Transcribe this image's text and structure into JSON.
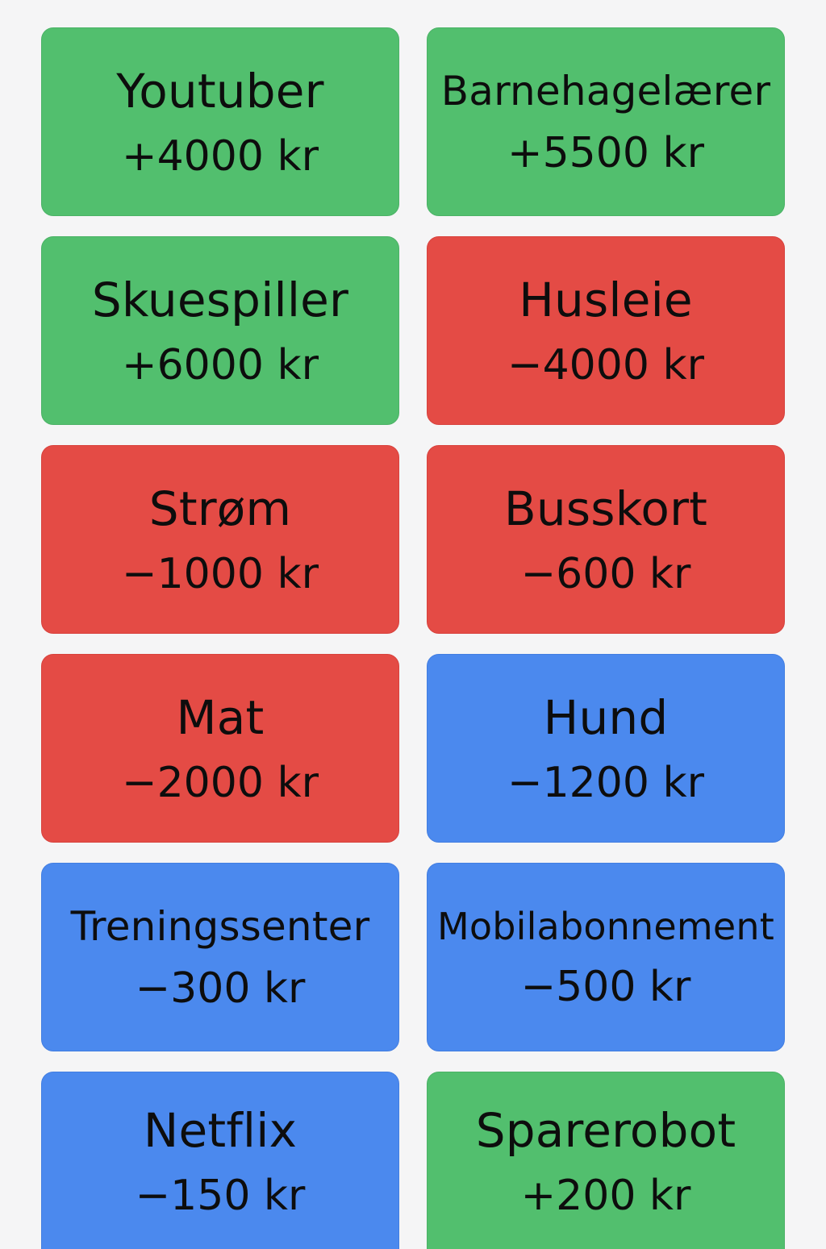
{
  "colors": {
    "background": "#f5f5f6",
    "income_green": "#52bf6e",
    "expense_red": "#e44b45",
    "optional_blue": "#4b89ee",
    "text": "#0d0d0d"
  },
  "cards": [
    {
      "title": "Youtuber",
      "amount": "+4000 kr",
      "color": "green"
    },
    {
      "title": "Barnehagelærer",
      "amount": "+5500 kr",
      "color": "green"
    },
    {
      "title": "Skuespiller",
      "amount": "+6000 kr",
      "color": "green"
    },
    {
      "title": "Husleie",
      "amount": "−4000 kr",
      "color": "red"
    },
    {
      "title": "Strøm",
      "amount": "−1000 kr",
      "color": "red"
    },
    {
      "title": "Busskort",
      "amount": "−600 kr",
      "color": "red"
    },
    {
      "title": "Mat",
      "amount": "−2000 kr",
      "color": "red"
    },
    {
      "title": "Hund",
      "amount": "−1200 kr",
      "color": "blue"
    },
    {
      "title": "Treningssenter",
      "amount": "−300 kr",
      "color": "blue"
    },
    {
      "title": "Mobilabonnement",
      "amount": "−500 kr",
      "color": "blue"
    },
    {
      "title": "Netflix",
      "amount": "−150 kr",
      "color": "blue"
    },
    {
      "title": "Sparerobot",
      "amount": "+200 kr",
      "color": "green"
    }
  ]
}
